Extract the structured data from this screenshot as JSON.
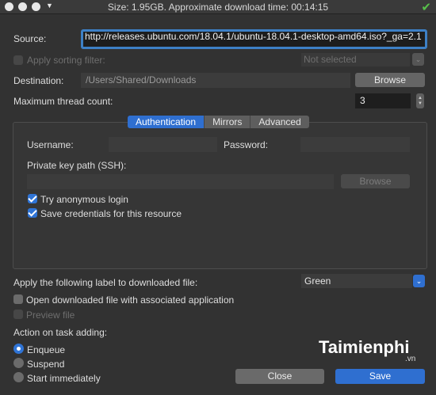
{
  "window": {
    "title": "Size: 1.95GB. Approximate download time: 00:14:15"
  },
  "form": {
    "source_label": "Source:",
    "source_value": "http://releases.ubuntu.com/18.04.1/ubuntu-18.04.1-desktop-amd64.iso?_ga=2.1",
    "sorting_filter_label": "Apply sorting filter:",
    "sorting_filter_value": "Not selected",
    "destination_label": "Destination:",
    "destination_value": "/Users/Shared/Downloads",
    "browse_label": "Browse",
    "thread_label": "Maximum thread count:",
    "thread_value": "3"
  },
  "tabs": [
    "Authentication",
    "Mirrors",
    "Advanced"
  ],
  "auth": {
    "username_label": "Username:",
    "password_label": "Password:",
    "key_path_label": "Private key path (SSH):",
    "browse_label": "Browse",
    "anonymous_label": "Try anonymous login",
    "save_credentials_label": "Save credentials for this resource"
  },
  "options": {
    "label_label": "Apply the following label to downloaded file:",
    "label_value": "Green",
    "open_with_label": "Open downloaded file with associated application",
    "preview_label": "Preview file",
    "action_label": "Action on task adding:",
    "radio_enqueue": "Enqueue",
    "radio_suspend": "Suspend",
    "radio_start": "Start immediately"
  },
  "buttons": {
    "close": "Close",
    "save": "Save"
  },
  "watermark": {
    "brand": "Taimienphi",
    "suffix": ".vn"
  },
  "colors": {
    "accent": "#2f6fd0",
    "background": "#323232",
    "success": "#57c04a"
  }
}
